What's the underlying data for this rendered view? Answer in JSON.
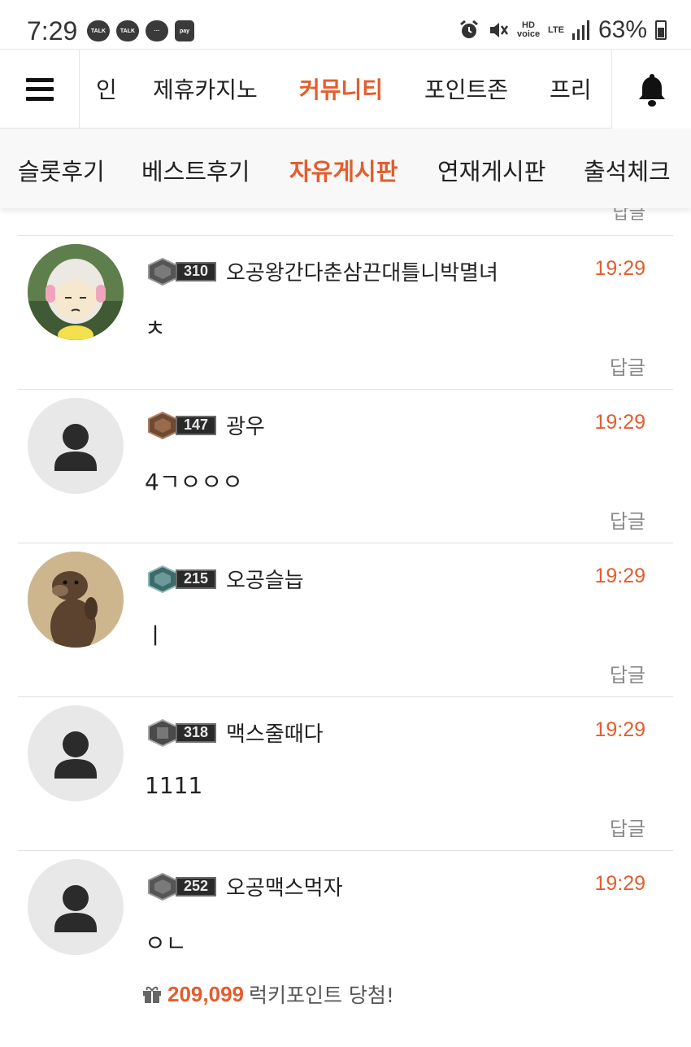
{
  "status_bar": {
    "time": "7:29",
    "notifications": [
      "TALK",
      "TALK",
      "···",
      "pay"
    ],
    "hd_voice": "HD voice",
    "network": "LTE",
    "battery": "63%"
  },
  "top_nav": {
    "items": [
      "인",
      "제휴카지노",
      "커뮤니티",
      "포인트존",
      "프리"
    ],
    "active": "커뮤니티"
  },
  "sub_nav": {
    "items": [
      "슬롯후기",
      "베스트후기",
      "자유게시판",
      "연재게시판",
      "출석체크"
    ],
    "active": "자유게시판"
  },
  "reply_label": "답글",
  "comments": [
    {
      "level": "310",
      "nickname": "오공왕간다춘삼끈대틀니박멸녀",
      "time": "19:29",
      "text": "ㅊ",
      "avatar": "anime-girl"
    },
    {
      "level": "147",
      "nickname": "광우",
      "time": "19:29",
      "text": "4ㄱㅇㅇㅇ",
      "avatar": "default"
    },
    {
      "level": "215",
      "nickname": "오공슬늡",
      "time": "19:29",
      "text": "ㅣ",
      "avatar": "otter"
    },
    {
      "level": "318",
      "nickname": "맥스줄때다",
      "time": "19:29",
      "text": "1111",
      "avatar": "default"
    },
    {
      "level": "252",
      "nickname": "오공맥스먹자",
      "time": "19:29",
      "text": "ㅇㄴ",
      "avatar": "default"
    }
  ],
  "lucky_point": {
    "amount": "209,099",
    "text": "럭키포인트 당첨!"
  },
  "colors": {
    "accent": "#e35d2e",
    "muted": "#8a8a8a",
    "divider": "#e2e2e2"
  }
}
